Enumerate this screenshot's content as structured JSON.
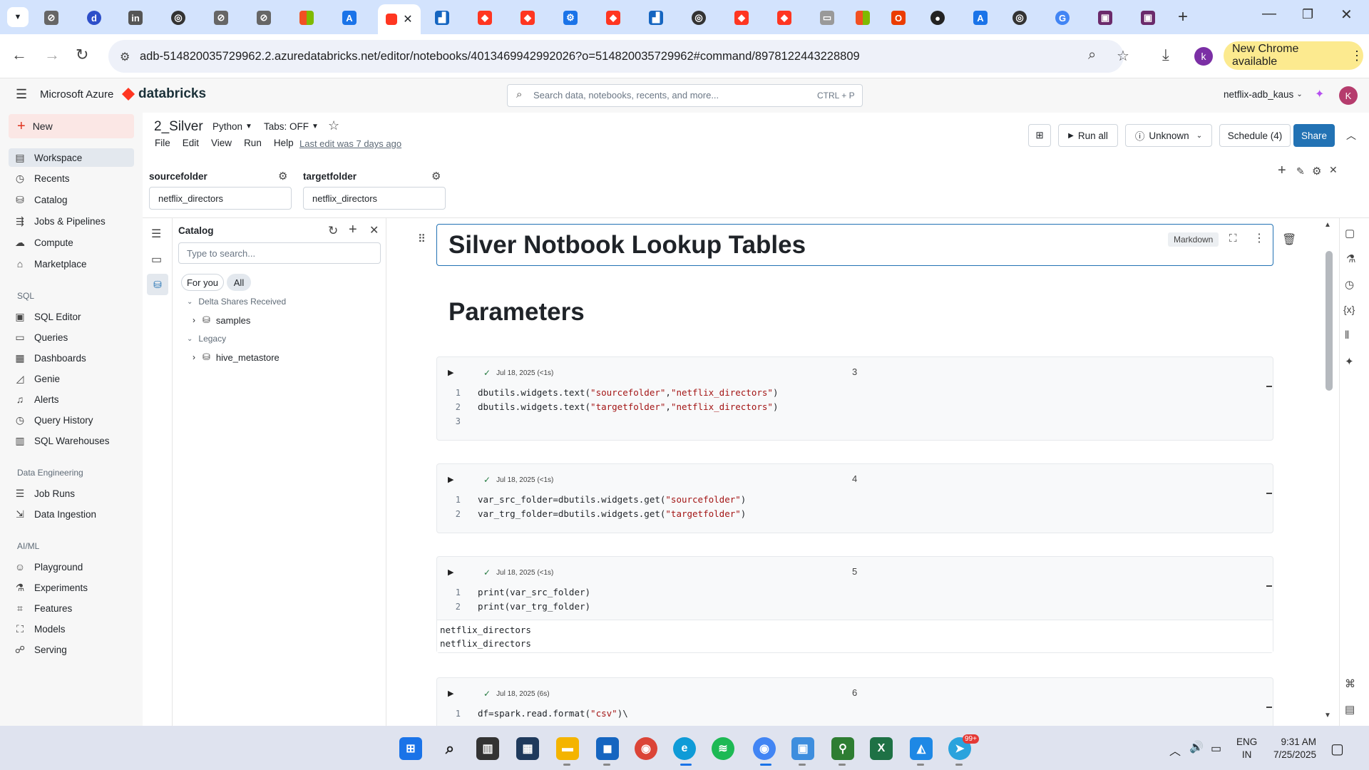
{
  "browser": {
    "url": "adb-514820035729962.2.azuredatabricks.net/editor/notebooks/4013469942992026?o=514820035729962#command/8978122443228809",
    "update_label": "New Chrome available",
    "profile_initial": "k"
  },
  "header": {
    "product": "Microsoft Azure",
    "brand": "databricks",
    "search_placeholder": "Search data, notebooks, recents, and more...",
    "search_shortcut": "CTRL + P",
    "workspace": "netflix-adb_kaus",
    "avatar": "K"
  },
  "sidebar": {
    "new_label": "New",
    "items": [
      {
        "label": "Workspace",
        "icon": "folder-icon"
      },
      {
        "label": "Recents",
        "icon": "clock-icon"
      },
      {
        "label": "Catalog",
        "icon": "catalog-icon"
      },
      {
        "label": "Jobs & Pipelines",
        "icon": "jobs-icon"
      },
      {
        "label": "Compute",
        "icon": "compute-icon"
      },
      {
        "label": "Marketplace",
        "icon": "store-icon"
      }
    ],
    "sql_heading": "SQL",
    "sql_items": [
      {
        "label": "SQL Editor"
      },
      {
        "label": "Queries"
      },
      {
        "label": "Dashboards"
      },
      {
        "label": "Genie"
      },
      {
        "label": "Alerts"
      },
      {
        "label": "Query History"
      },
      {
        "label": "SQL Warehouses"
      }
    ],
    "de_heading": "Data Engineering",
    "de_items": [
      {
        "label": "Job Runs"
      },
      {
        "label": "Data Ingestion"
      }
    ],
    "ai_heading": "AI/ML",
    "ai_items": [
      {
        "label": "Playground"
      },
      {
        "label": "Experiments"
      },
      {
        "label": "Features"
      },
      {
        "label": "Models"
      },
      {
        "label": "Serving"
      }
    ]
  },
  "notebook": {
    "title": "2_Silver",
    "language": "Python",
    "tabs": "Tabs: OFF",
    "menu": [
      "File",
      "Edit",
      "View",
      "Run",
      "Help"
    ],
    "last_edit": "Last edit was 7 days ago",
    "run_all": "Run all",
    "compute": "Unknown",
    "schedule": "Schedule (4)",
    "share": "Share"
  },
  "widgets": [
    {
      "name": "sourcefolder",
      "value": "netflix_directors"
    },
    {
      "name": "targetfolder",
      "value": "netflix_directors"
    }
  ],
  "catalog": {
    "title": "Catalog",
    "search_placeholder": "Type to search...",
    "filter_for_you": "For you",
    "filter_all": "All",
    "groups": [
      {
        "label": "Delta Shares Received",
        "child": "samples"
      },
      {
        "label": "Legacy",
        "child": "hive_metastore"
      }
    ]
  },
  "cells": {
    "title_md": "Silver Notbook Lookup Tables",
    "markdown_badge": "Markdown",
    "params_heading": "Parameters",
    "c3": {
      "status": "Jul 18, 2025 (<1s)",
      "num": "3"
    },
    "c4": {
      "status": "Jul 18, 2025 (<1s)",
      "num": "4"
    },
    "c5": {
      "status": "Jul 18, 2025 (<1s)",
      "num": "5",
      "out1": "netflix_directors",
      "out2": "netflix_directors"
    },
    "c6": {
      "status": "Jul 18, 2025 (6s)",
      "num": "6"
    }
  },
  "taskbar": {
    "lang": "ENG",
    "region": "IN",
    "time": "9:31 AM",
    "date": "7/25/2025",
    "badge": "99+"
  }
}
